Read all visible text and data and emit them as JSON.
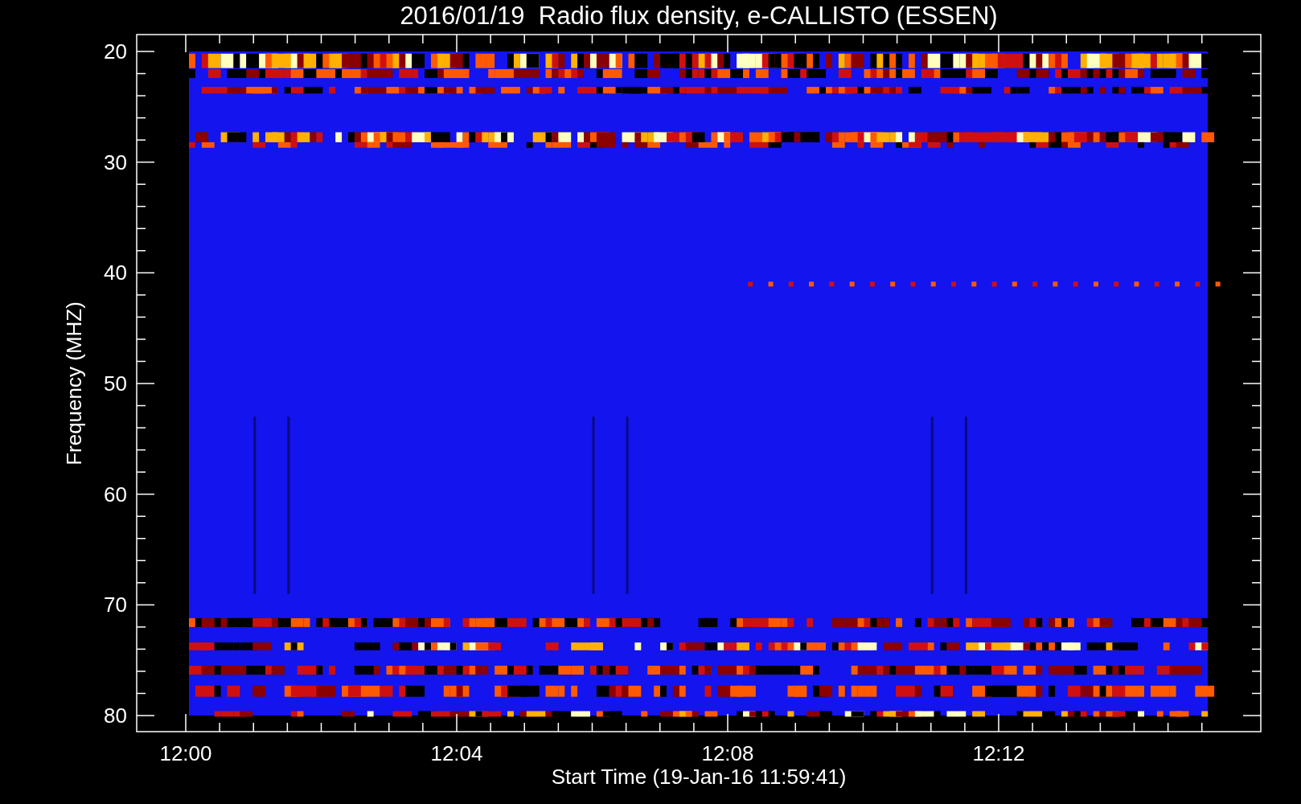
{
  "title": "2016/01/19  Radio flux density, e-CALLISTO (ESSEN)",
  "y_axis": {
    "label": "Frequency (MHZ)",
    "ticks": [
      "20",
      "30",
      "40",
      "50",
      "60",
      "70",
      "80"
    ]
  },
  "x_axis": {
    "label": "Start Time (19-Jan-16 11:59:41)",
    "ticks": [
      "12:00",
      "12:04",
      "12:08",
      "12:12"
    ]
  }
}
